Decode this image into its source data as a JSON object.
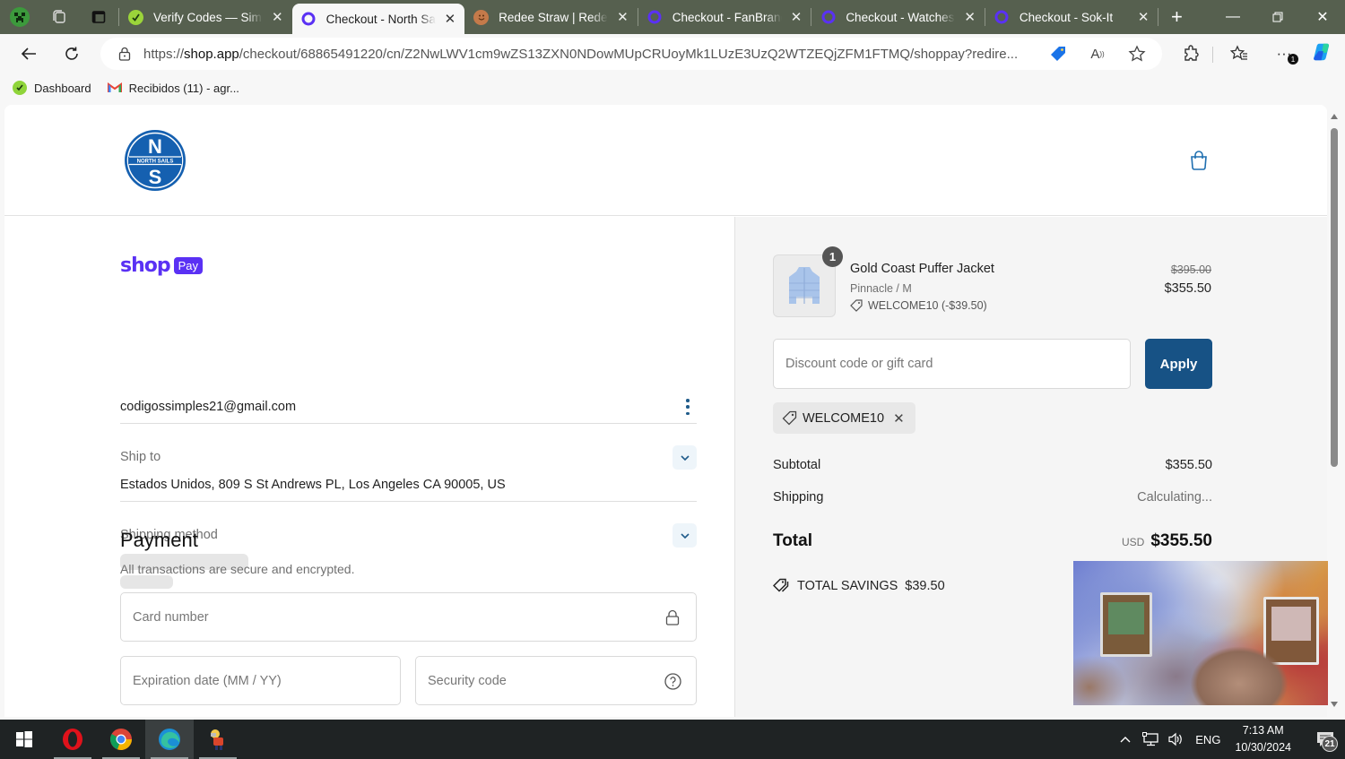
{
  "browser": {
    "tabs": [
      {
        "title": "Verify Codes — Simple",
        "active": false,
        "favicon": "green-check-icon"
      },
      {
        "title": "Checkout - North Sails",
        "active": true,
        "favicon": "shop-icon"
      },
      {
        "title": "Redee Straw | Redee",
        "active": false,
        "favicon": "smiley-icon"
      },
      {
        "title": "Checkout - FanBrand",
        "active": false,
        "favicon": "shop-icon"
      },
      {
        "title": "Checkout - Watches",
        "active": false,
        "favicon": "shop-icon"
      },
      {
        "title": "Checkout - Sok-It",
        "active": false,
        "favicon": "shop-icon"
      }
    ],
    "new_tab_label": "+",
    "url_prefix": "https://",
    "url_domain": "shop.app",
    "url_rest": "/checkout/68865491220/cn/Z2NwLWV1cm9wZS13ZXN0NDowMUpCRUoyMk1LUzE3UzQ2WTZEQjZFM1FTMQ/shoppay?redire...",
    "notification_count": "1",
    "bookmarks": [
      {
        "label": "Dashboard",
        "icon": "green-check-icon"
      },
      {
        "label": "Recibidos (11) - agr...",
        "icon": "gmail-icon"
      }
    ]
  },
  "store": {
    "brand_line1": "N",
    "brand_line2": "NORTH SAILS",
    "brand_line3": "S",
    "accent_color": "#175285"
  },
  "checkout": {
    "shoppay_word": "shop",
    "shoppay_badge": "Pay",
    "email": "codigossimples21@gmail.com",
    "ship_to_label": "Ship to",
    "ship_to_value": "Estados Unidos, 809 S St Andrews PL, Los Angeles CA 90005, US",
    "shipping_method_label": "Shipping method",
    "payment_title": "Payment",
    "payment_subtitle": "All transactions are secure and encrypted.",
    "card_number_placeholder": "Card number",
    "expiry_placeholder": "Expiration date (MM / YY)",
    "security_code_placeholder": "Security code"
  },
  "summary": {
    "item": {
      "quantity": "1",
      "name": "Gold Coast Puffer Jacket",
      "variant": "Pinnacle / M",
      "discount": "WELCOME10 (-$39.50)",
      "original_price": "$395.00",
      "price": "$355.50"
    },
    "discount_placeholder": "Discount code or gift card",
    "apply_label": "Apply",
    "applied_code": "WELCOME10",
    "subtotal_label": "Subtotal",
    "subtotal_value": "$355.50",
    "shipping_label": "Shipping",
    "shipping_value": "Calculating...",
    "total_label": "Total",
    "total_currency": "USD",
    "total_value": "$355.50",
    "savings_label": "TOTAL SAVINGS",
    "savings_value": "$39.50"
  },
  "taskbar": {
    "apps": [
      "start-button",
      "opera",
      "chrome",
      "edge",
      "game-app"
    ],
    "language": "ENG",
    "time": "7:13 AM",
    "date": "10/30/2024",
    "notifications": "21"
  }
}
